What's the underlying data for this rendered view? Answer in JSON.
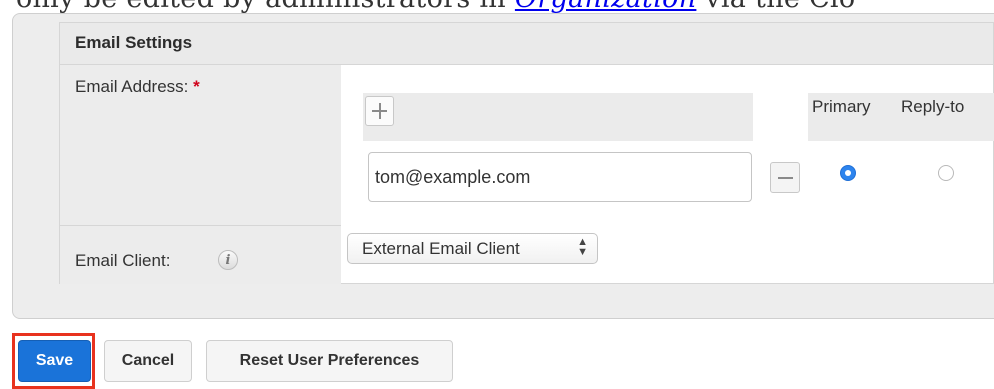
{
  "intro": {
    "prefix": "only be edited by administrators in ",
    "link": "Organization",
    "suffix": " via the Clo"
  },
  "section": {
    "title": "Email Settings"
  },
  "email_address": {
    "label": "Email Address:",
    "required_marker": "*",
    "add_icon": "plus-icon",
    "columns": {
      "primary": "Primary",
      "reply_to": "Reply-to"
    },
    "rows": [
      {
        "value": "tom@example.com",
        "primary": true,
        "reply_to": false,
        "remove_icon": "minus-icon"
      }
    ]
  },
  "email_client": {
    "label": "Email Client:",
    "info_glyph": "i",
    "info_icon": "info-icon",
    "selected": "External Email Client",
    "arrow_up": "▲",
    "arrow_down": "▼"
  },
  "actions": {
    "save": "Save",
    "cancel": "Cancel",
    "reset": "Reset User Preferences"
  },
  "colors": {
    "primary_button": "#1a73d9",
    "highlight_border": "#e8321e",
    "required": "#d0021b",
    "radio_selected": "#2d84ee"
  }
}
